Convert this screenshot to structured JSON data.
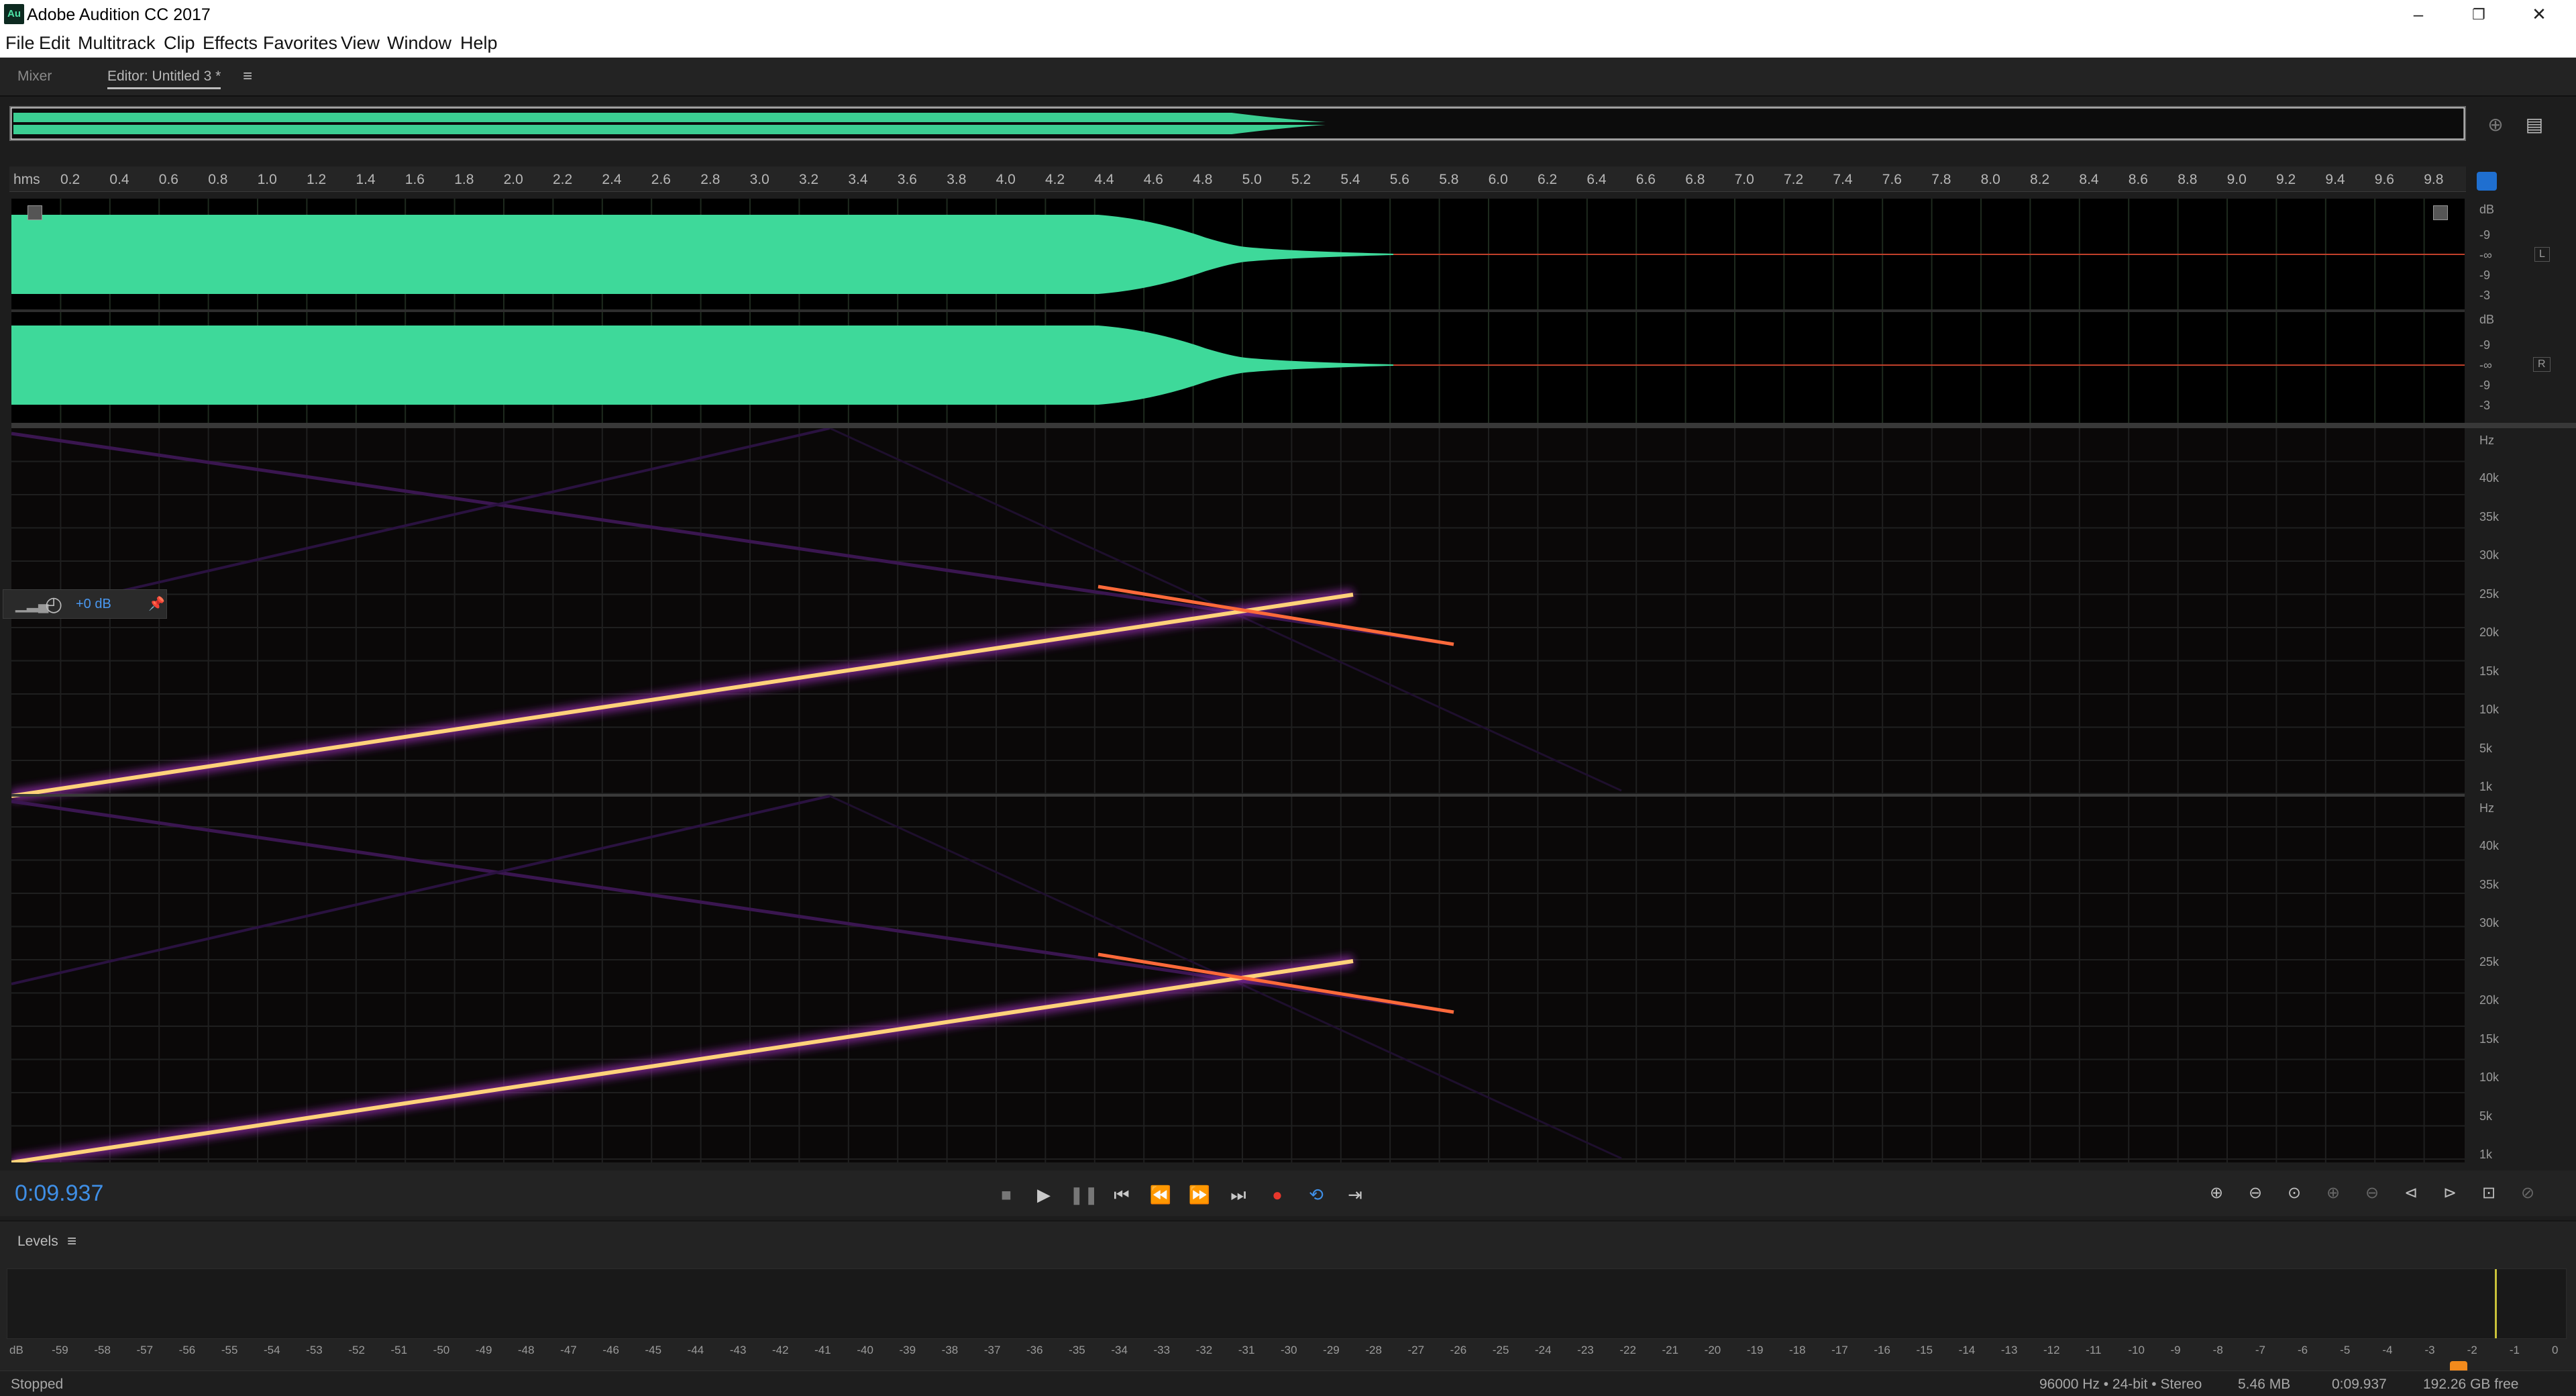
{
  "app": {
    "icon_text": "Au",
    "title": "Adobe Audition CC 2017"
  },
  "window_controls": {
    "minimize": "–",
    "maximize": "❐",
    "close": "✕"
  },
  "menu": [
    "File",
    "Edit",
    "Multitrack",
    "Clip",
    "Effects",
    "Favorites",
    "View",
    "Window",
    "Help"
  ],
  "panels": {
    "mixer_tab": "Mixer",
    "editor_tab": "Editor: Untitled 3 *",
    "menu_icon": "≡"
  },
  "ruler": {
    "unit": "hms",
    "ticks": [
      "0.2",
      "0.4",
      "0.6",
      "0.8",
      "1.0",
      "1.2",
      "1.4",
      "1.6",
      "1.8",
      "2.0",
      "2.2",
      "2.4",
      "2.6",
      "2.8",
      "3.0",
      "3.2",
      "3.4",
      "3.6",
      "3.8",
      "4.0",
      "4.2",
      "4.4",
      "4.6",
      "4.8",
      "5.0",
      "5.2",
      "5.4",
      "5.6",
      "5.8",
      "6.0",
      "6.2",
      "6.4",
      "6.6",
      "6.8",
      "7.0",
      "7.2",
      "7.4",
      "7.6",
      "7.8",
      "8.0",
      "8.2",
      "8.4",
      "8.6",
      "8.8",
      "9.0",
      "9.2",
      "9.4",
      "9.6",
      "9.8"
    ]
  },
  "amplitude_scale": {
    "unit": "dB",
    "labels": [
      "-9",
      "-∞",
      "-9",
      "-3"
    ],
    "left_channel": "L",
    "right_channel": "R"
  },
  "frequency_scale": {
    "unit": "Hz",
    "labels": [
      "40k",
      "35k",
      "30k",
      "25k",
      "20k",
      "15k",
      "10k",
      "5k",
      "1k"
    ]
  },
  "hud": {
    "gain": "+0 dB"
  },
  "transport": {
    "time": "0:09.937",
    "buttons": [
      "stop",
      "play",
      "pause",
      "previous",
      "rewind",
      "fast-forward",
      "next",
      "record",
      "loop",
      "skip-selection"
    ]
  },
  "levels": {
    "title": "Levels",
    "scale": [
      "dB",
      "-59",
      "-58",
      "-57",
      "-56",
      "-55",
      "-54",
      "-53",
      "-52",
      "-51",
      "-50",
      "-49",
      "-48",
      "-47",
      "-46",
      "-45",
      "-44",
      "-43",
      "-42",
      "-41",
      "-40",
      "-39",
      "-38",
      "-37",
      "-36",
      "-35",
      "-34",
      "-33",
      "-32",
      "-31",
      "-30",
      "-29",
      "-28",
      "-27",
      "-26",
      "-25",
      "-24",
      "-23",
      "-22",
      "-21",
      "-20",
      "-19",
      "-18",
      "-17",
      "-16",
      "-15",
      "-14",
      "-13",
      "-12",
      "-11",
      "-10",
      "-9",
      "-8",
      "-7",
      "-6",
      "-5",
      "-4",
      "-3",
      "-2",
      "-1",
      "0"
    ]
  },
  "status": {
    "state": "Stopped",
    "format": "96000 Hz • 24-bit • Stereo",
    "size": "5.46 MB",
    "duration": "0:09.937",
    "free": "192.26 GB free"
  },
  "colors": {
    "waveform": "#3ed99a",
    "accent": "#3f8fe6",
    "record": "#e8372c",
    "spectral_hot": "#ffd27a"
  }
}
